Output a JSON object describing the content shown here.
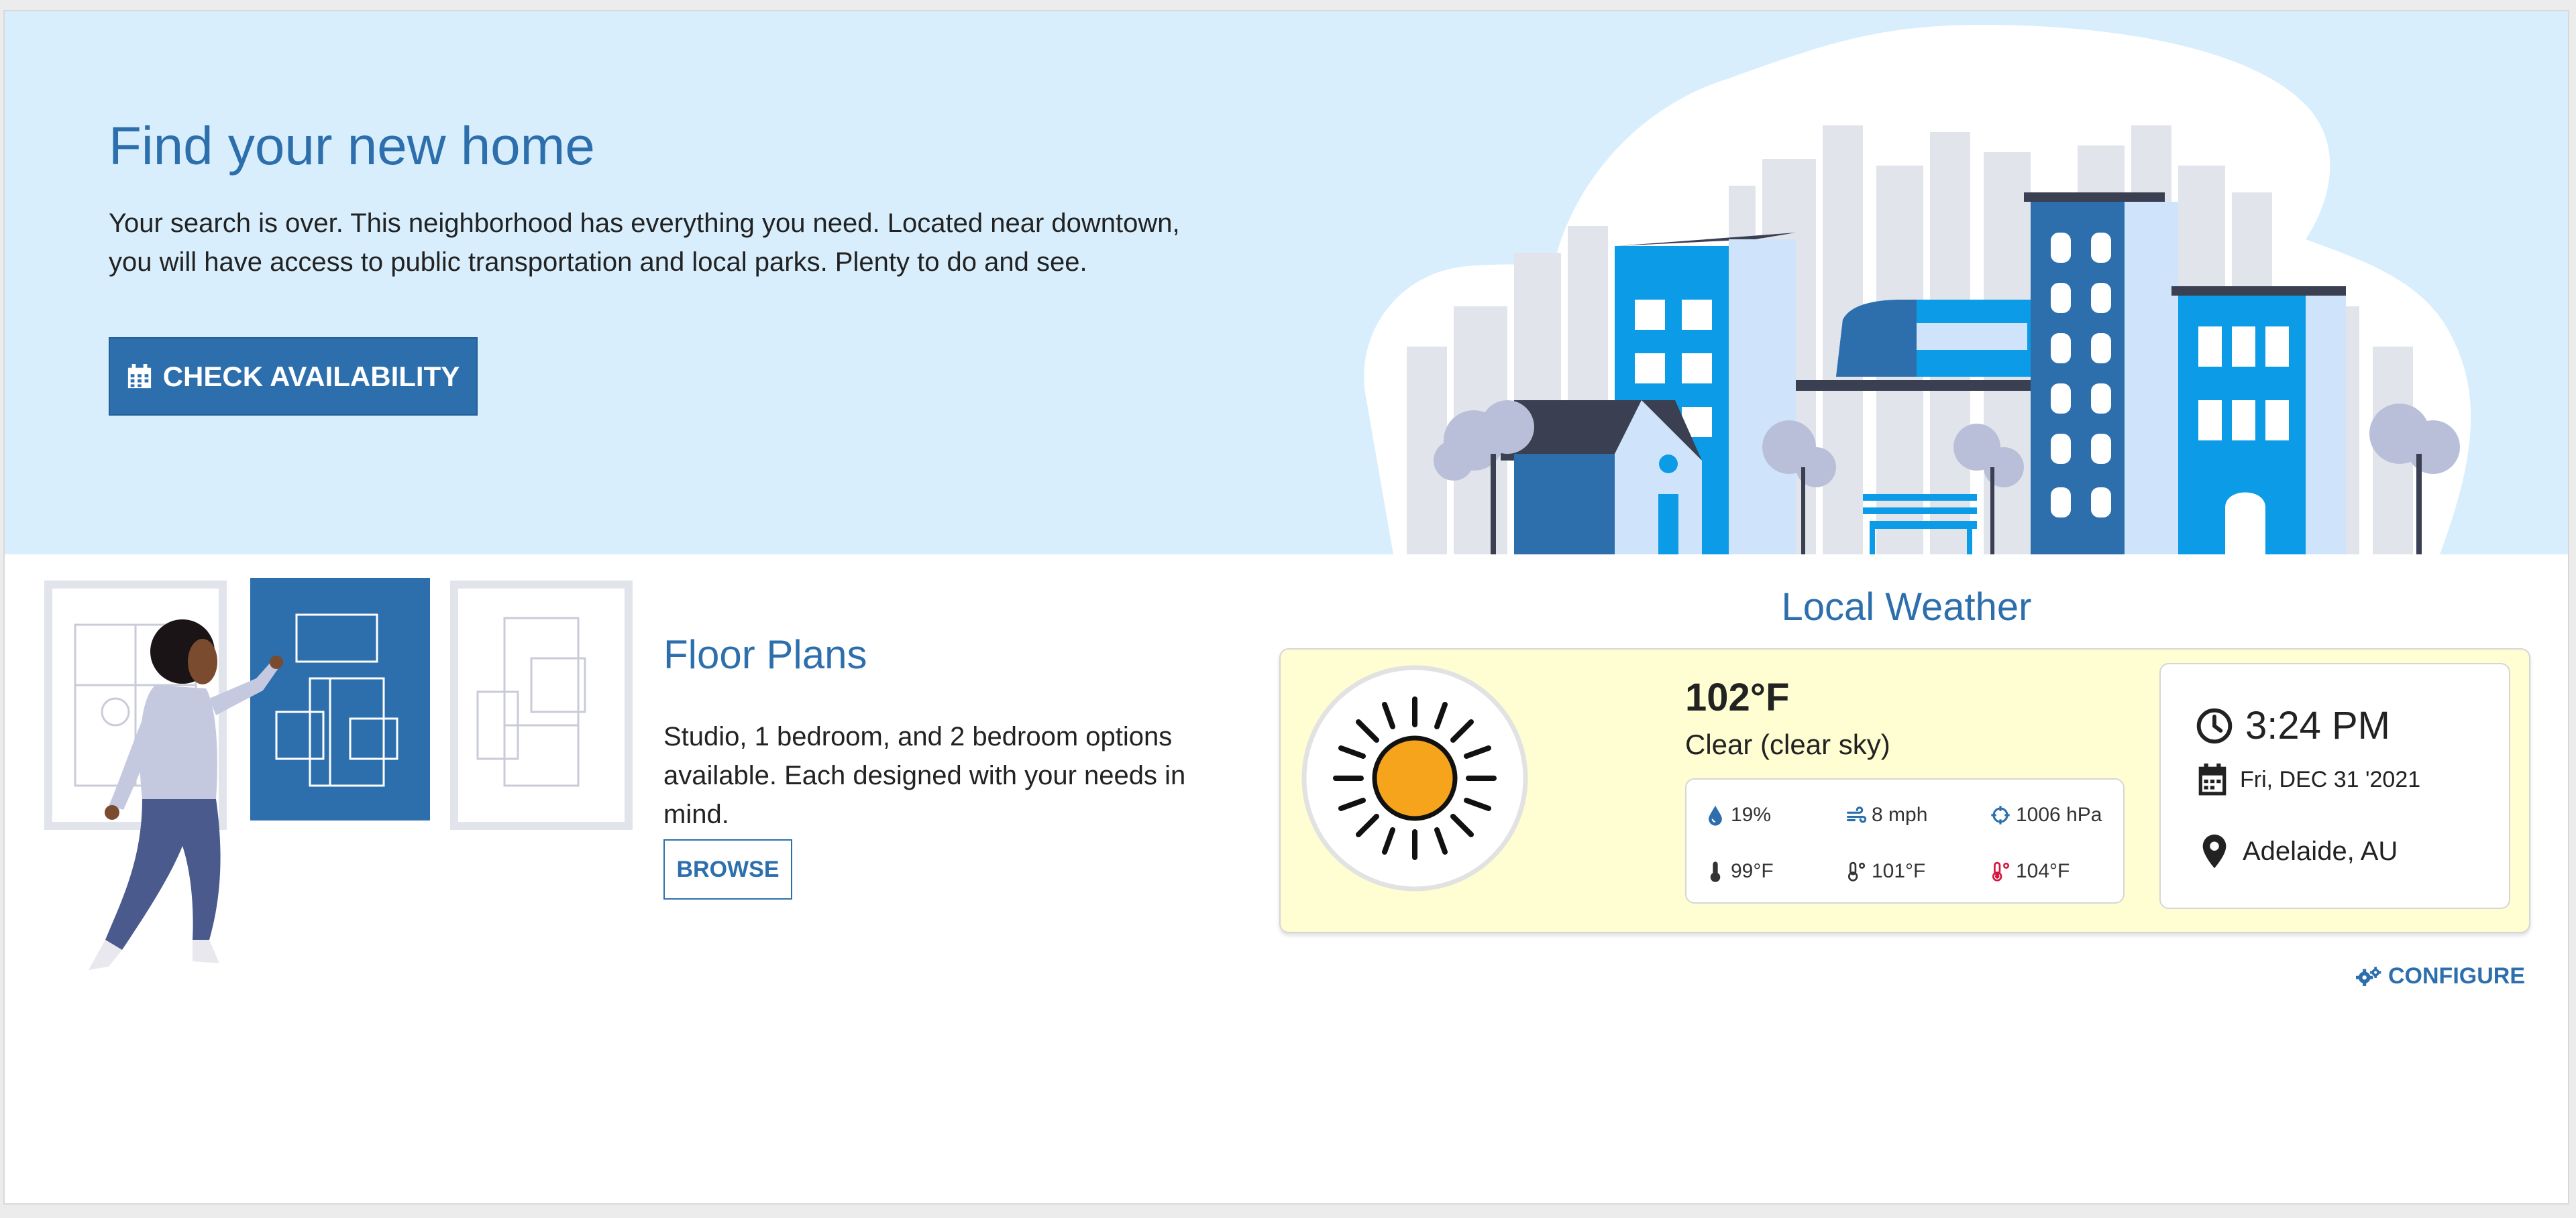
{
  "hero": {
    "title": "Find your new home",
    "description": "Your search is over. This neighborhood has everything you need. Located near downtown, you will have access to public transportation and local parks. Plenty to do and see.",
    "button_label": "CHECK AVAILABILITY",
    "button_icon": "calendar-icon",
    "background_color": "#d8eefc",
    "accent_color": "#2d6fac"
  },
  "floor_plans": {
    "title": "Floor Plans",
    "description": "Studio, 1 bedroom, and 2 bedroom options available. Each designed with your needs in mind.",
    "button_label": "BROWSE"
  },
  "weather": {
    "heading": "Local Weather",
    "card_color": "#fefed2",
    "icon": "sun-icon",
    "temperature": "102°F",
    "condition": "Clear (clear sky)",
    "details": {
      "humidity": "19%",
      "wind": "8 mph",
      "pressure": "1006 hPa",
      "temp_min": "99°F",
      "feels_like": "101°F",
      "temp_max": "104°F"
    },
    "time": "3:24 PM",
    "date": "Fri, DEC 31 '2021",
    "location": "Adelaide, AU",
    "configure_label": "CONFIGURE"
  }
}
